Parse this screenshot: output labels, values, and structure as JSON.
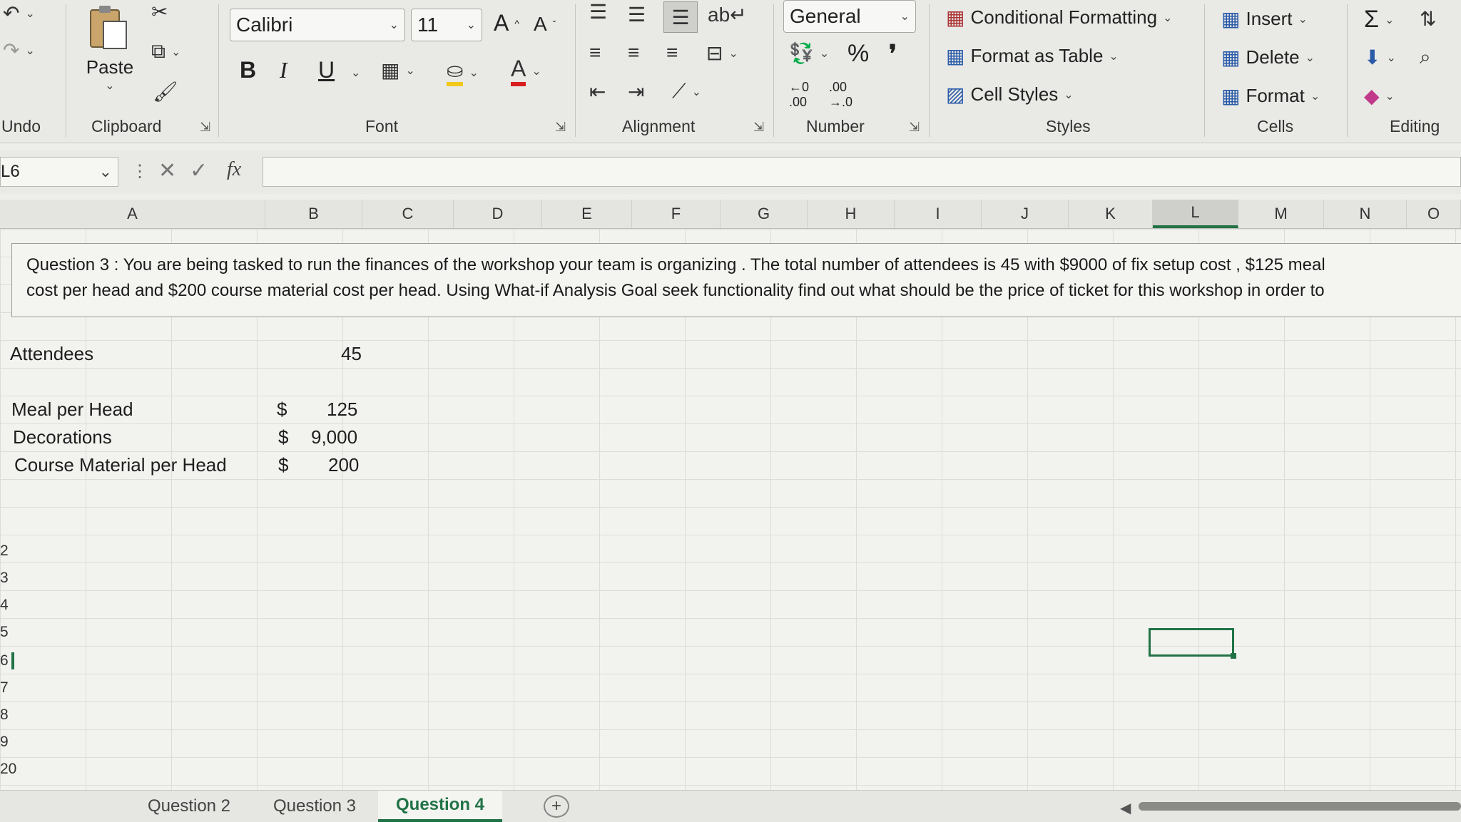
{
  "ribbon": {
    "undo_label": "Undo",
    "clipboard": {
      "paste_label": "Paste",
      "group_label": "Clipboard"
    },
    "font": {
      "font_name": "Calibri",
      "font_size": "11",
      "group_label": "Font",
      "bold": "B",
      "italic": "I",
      "underline": "U",
      "grow": "A",
      "shrink": "A",
      "font_color_glyph": "A"
    },
    "alignment": {
      "group_label": "Alignment"
    },
    "number": {
      "format": "General",
      "percent": "%",
      "comma": "❜",
      "group_label": "Number"
    },
    "styles": {
      "conditional": "Conditional Formatting",
      "format_table": "Format as Table",
      "cell_styles": "Cell Styles",
      "group_label": "Styles"
    },
    "cells": {
      "insert": "Insert",
      "delete": "Delete",
      "format": "Format",
      "group_label": "Cells"
    },
    "editing": {
      "group_label": "Editing",
      "sum": "Σ"
    }
  },
  "formula_bar": {
    "name_box": "L6",
    "fx": "fx",
    "value": ""
  },
  "columns": [
    "A",
    "B",
    "C",
    "D",
    "E",
    "F",
    "G",
    "H",
    "I",
    "J",
    "K",
    "L",
    "M",
    "N",
    "O"
  ],
  "selected_column": "L",
  "sheet": {
    "question_line1": "Question 3 : You are being tasked to run the finances of the workshop your team is organizing . The total number of attendees is 45 with $9000 of fix setup cost , $125 meal",
    "question_line2": "cost per head and $200 course material cost per head. Using What-if Analysis Goal seek functionality find out what should be the price of ticket for this workshop in order to",
    "rows": [
      {
        "label": "Attendees",
        "currency": "",
        "value": "45"
      },
      {
        "label": "Meal per Head",
        "currency": "$",
        "value": "125"
      },
      {
        "label": "Decorations",
        "currency": "$",
        "value": "9,000"
      },
      {
        "label": "Course Material per Head",
        "currency": "$",
        "value": "200"
      }
    ]
  },
  "row_numbers": [
    "",
    "2",
    "3",
    "4",
    "5",
    "6",
    "7",
    "8",
    "9",
    "20"
  ],
  "tabs": {
    "items": [
      "Question 2",
      "Question 3",
      "Question 4"
    ],
    "active": "Question 4",
    "add_label": "+"
  }
}
